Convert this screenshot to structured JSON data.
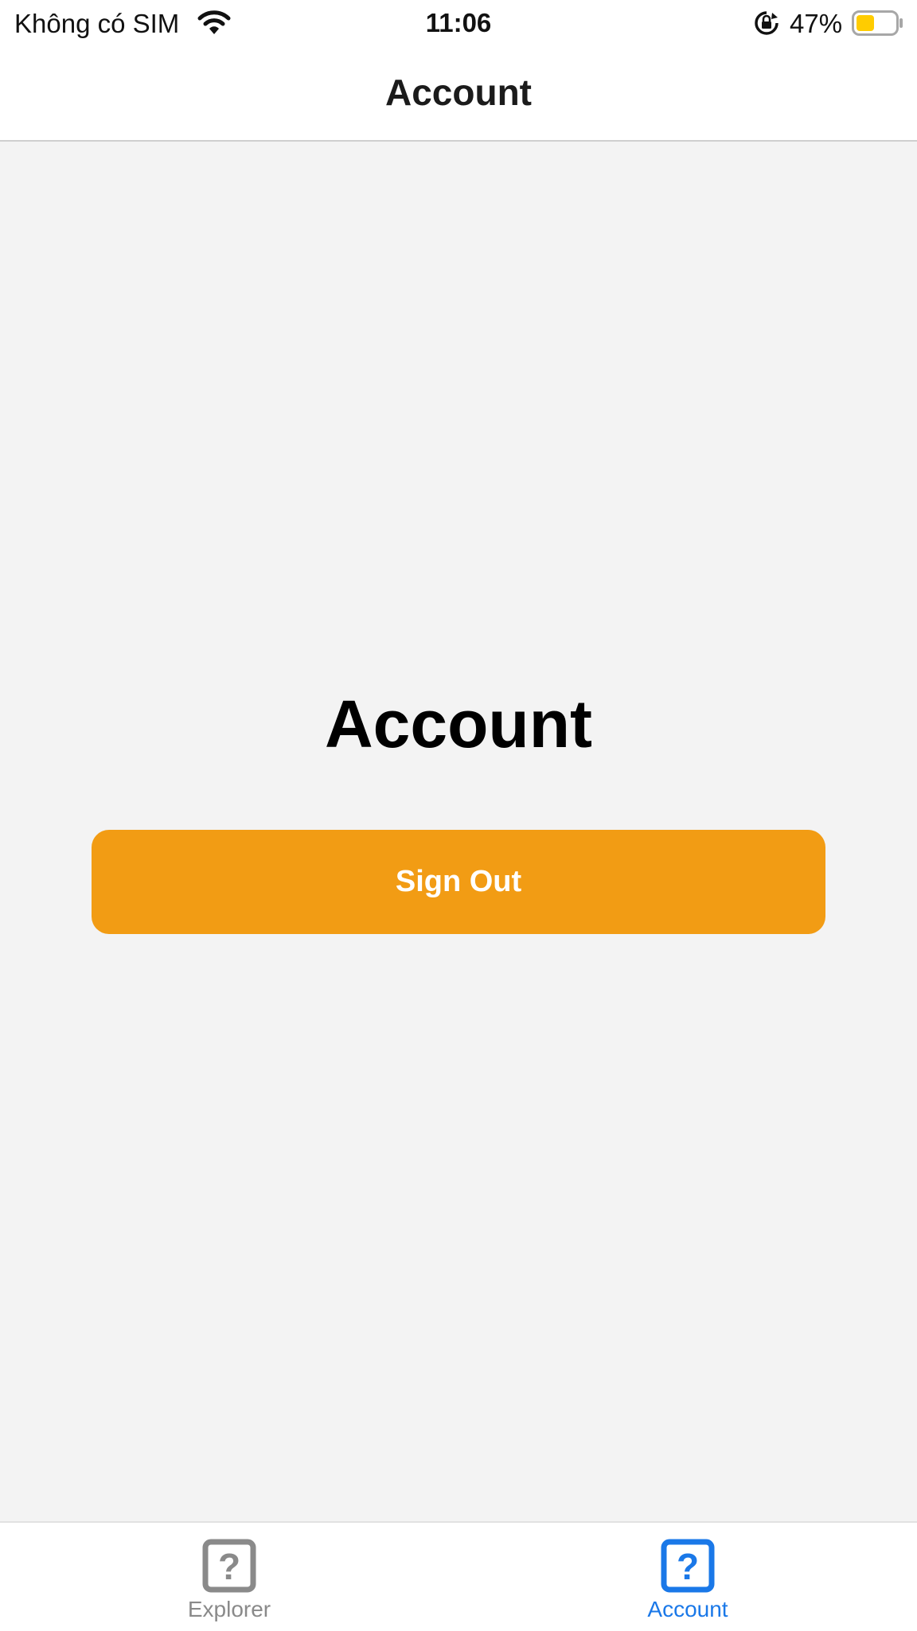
{
  "status_bar": {
    "carrier": "Không có SIM",
    "time": "11:06",
    "battery_percent": "47%",
    "battery_level": 0.47,
    "battery_color": "#ffcc00",
    "icons": [
      "wifi-icon",
      "orientation-lock-icon",
      "battery-icon"
    ]
  },
  "header": {
    "title": "Account"
  },
  "main": {
    "title": "Account",
    "sign_out_label": "Sign Out",
    "sign_out_color": "#f29c14"
  },
  "tab_bar": {
    "items": [
      {
        "label": "Explorer",
        "icon": "question-square-icon",
        "selected": false,
        "color": "#8a8a8a"
      },
      {
        "label": "Account",
        "icon": "question-square-icon",
        "selected": true,
        "color": "#1a78e8"
      }
    ]
  },
  "colors": {
    "background": "#f3f3f3",
    "accent": "#1a78e8"
  }
}
